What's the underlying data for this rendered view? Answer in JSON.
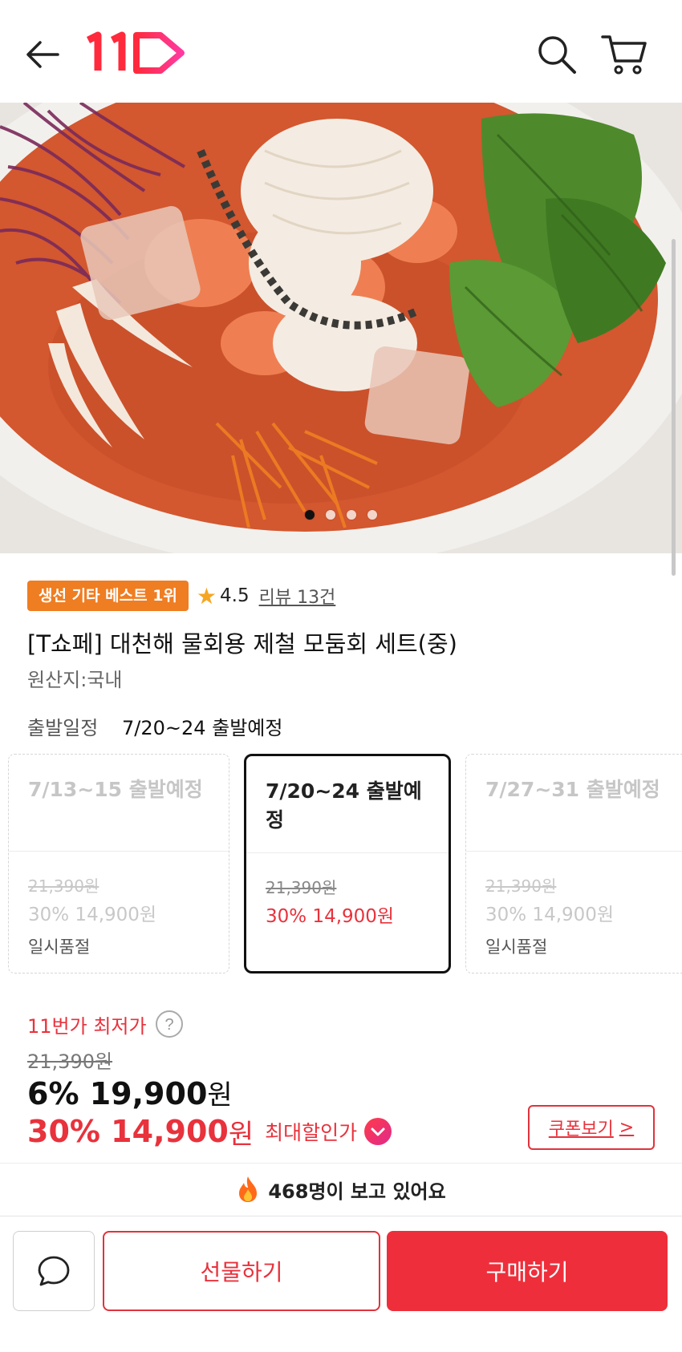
{
  "header": {
    "logo_text": "11",
    "icons": [
      "back-arrow-icon",
      "logo",
      "search-icon",
      "cart-icon"
    ]
  },
  "hero": {
    "carousel_total": 4,
    "carousel_active": 1
  },
  "product": {
    "badge": "생선 기타 베스트 1위",
    "rating": "4.5",
    "review_link": "리뷰 13건",
    "title": "[T쇼페] 대천해 물회용 제철 모둠회 세트(중)",
    "origin": "원산지:국내"
  },
  "departure": {
    "label": "출발일정",
    "value": "7/20~24 출발예정"
  },
  "options": [
    {
      "title": "7/13~15 출발예정",
      "orig_price": "21,390원",
      "sale": "30% 14,900원",
      "status": "일시품절",
      "selected": false
    },
    {
      "title": "7/20~24 출발예정",
      "orig_price": "21,390원",
      "sale": "30% 14,900원",
      "status": "",
      "selected": true
    },
    {
      "title": "7/27~31 출발예정",
      "orig_price": "21,390원",
      "sale": "30% 14,900원",
      "status": "일시품절",
      "selected": false
    }
  ],
  "price": {
    "lowest_label": "11번가 최저가",
    "original": "21,390원",
    "main_amount": "6% 19,900",
    "main_unit": "원",
    "sale_amount": "30% 14,900",
    "sale_unit": "원",
    "max_discount": "최대할인가",
    "coupon_button": "쿠폰보기",
    "coupon_chevron": ">"
  },
  "watching": "468명이 보고 있어요",
  "bottom": {
    "gift_button": "선물하기",
    "buy_button": "구매하기"
  },
  "colors": {
    "brand_red": "#e8323c",
    "badge_orange": "#ef7d22",
    "star": "#f5a623"
  }
}
